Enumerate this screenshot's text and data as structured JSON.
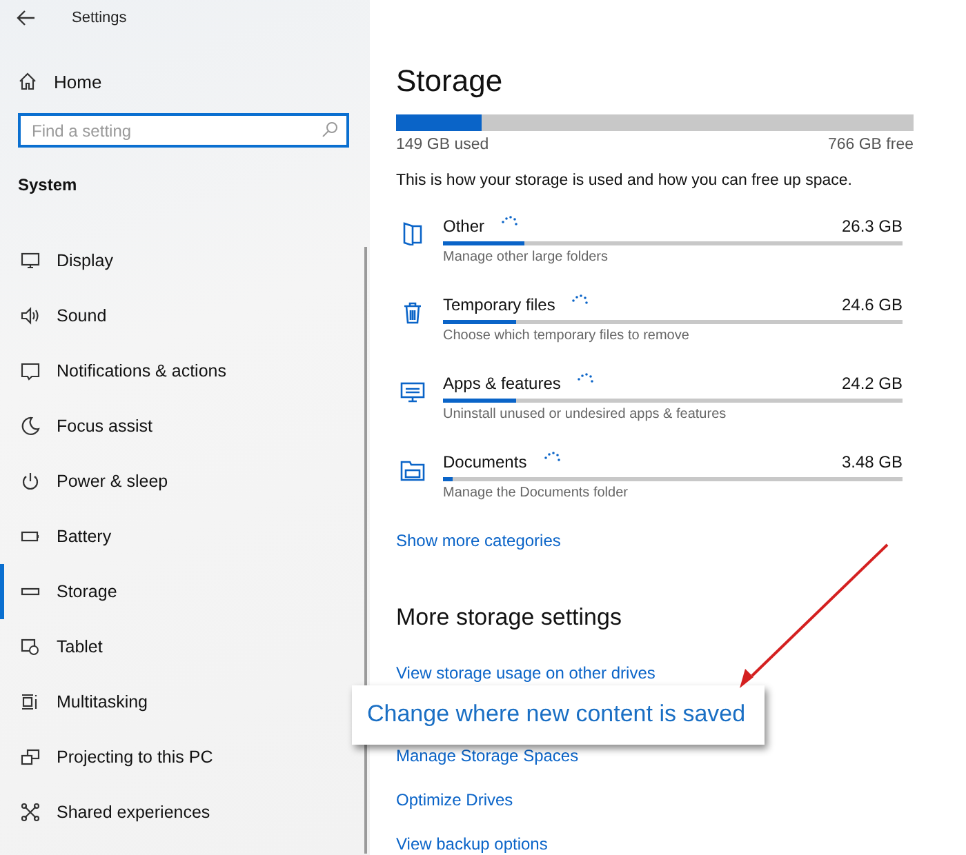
{
  "window": {
    "title": "Settings"
  },
  "sidebar": {
    "home": "Home",
    "search": {
      "placeholder": "Find a setting"
    },
    "section": "System",
    "items": [
      {
        "label": "Display",
        "selected": false
      },
      {
        "label": "Sound",
        "selected": false
      },
      {
        "label": "Notifications & actions",
        "selected": false
      },
      {
        "label": "Focus assist",
        "selected": false
      },
      {
        "label": "Power & sleep",
        "selected": false
      },
      {
        "label": "Battery",
        "selected": false
      },
      {
        "label": "Storage",
        "selected": true
      },
      {
        "label": "Tablet",
        "selected": false
      },
      {
        "label": "Multitasking",
        "selected": false
      },
      {
        "label": "Projecting to this PC",
        "selected": false
      },
      {
        "label": "Shared experiences",
        "selected": false
      }
    ]
  },
  "main": {
    "title": "Storage",
    "usage": {
      "level": 0.165,
      "used": "149 GB used",
      "free": "766 GB free"
    },
    "description": "This is how your storage is used and how you can free up space.",
    "categories": [
      {
        "name": "Other",
        "size": "26.3 GB",
        "level": 0.177,
        "hint": "Manage other large folders"
      },
      {
        "name": "Temporary files",
        "size": "24.6 GB",
        "level": 0.16,
        "hint": "Choose which temporary files to remove"
      },
      {
        "name": "Apps & features",
        "size": "24.2 GB",
        "level": 0.16,
        "hint": "Uninstall unused or undesired apps & features"
      },
      {
        "name": "Documents",
        "size": "3.48 GB",
        "level": 0.02,
        "hint": "Manage the Documents folder"
      }
    ],
    "show_more": "Show more categories",
    "more_heading": "More storage settings",
    "links": [
      "View storage usage on other drives",
      "Manage Storage Spaces",
      "Optimize Drives",
      "View backup options"
    ]
  },
  "callout": {
    "text": "Change where new content is saved"
  }
}
